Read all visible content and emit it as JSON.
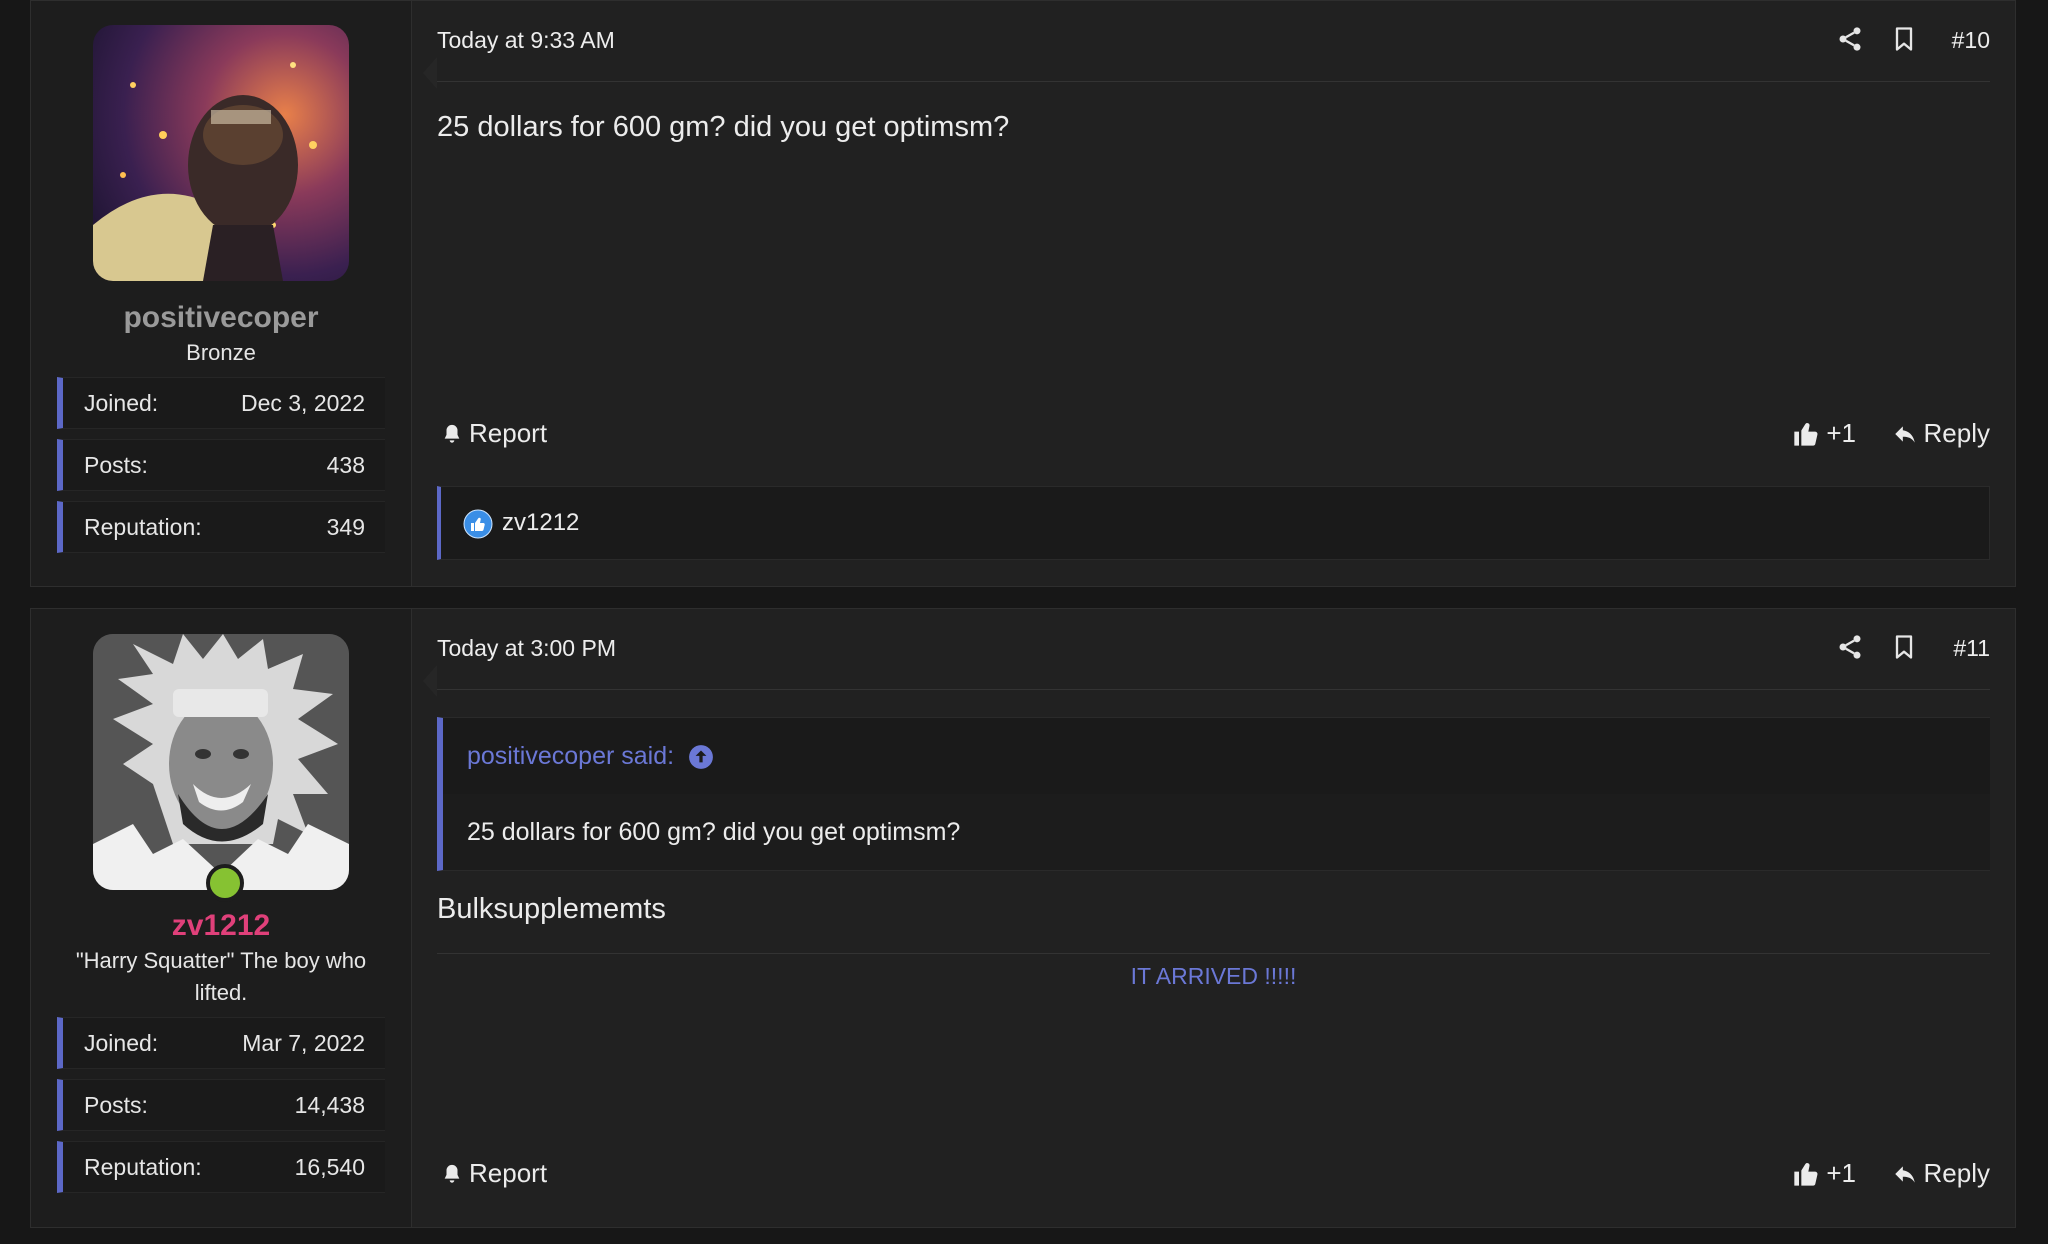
{
  "colors": {
    "accent": "#5c68c7",
    "link": "#6b78d6",
    "online": "#86c232",
    "username_highlight": "#e0407a",
    "username_muted": "#9a9a9a"
  },
  "posts": [
    {
      "username": "positivecoper",
      "user_title": "Bronze",
      "stats": [
        {
          "label": "Joined:",
          "value": "Dec 3, 2022"
        },
        {
          "label": "Posts:",
          "value": "438"
        },
        {
          "label": "Reputation:",
          "value": "349"
        }
      ],
      "date": "Today at 9:33 AM",
      "post_number": "#10",
      "body": "25 dollars for 600 gm? did you get optimsm?",
      "report_label": "Report",
      "like_label": "+1",
      "reply_label": "Reply",
      "likers": "zv1212"
    },
    {
      "username": "zv1212",
      "user_title": "\"Harry Squatter\" The boy who lifted.",
      "online": true,
      "stats": [
        {
          "label": "Joined:",
          "value": "Mar 7, 2022"
        },
        {
          "label": "Posts:",
          "value": "14,438"
        },
        {
          "label": "Reputation:",
          "value": "16,540"
        }
      ],
      "date": "Today at 3:00 PM",
      "post_number": "#11",
      "quote": {
        "author": "positivecoper said:",
        "text": "25 dollars for 600 gm? did you get optimsm?"
      },
      "body": "Bulksupplememts",
      "link_text": "IT ARRIVED !!!!!",
      "report_label": "Report",
      "like_label": "+1",
      "reply_label": "Reply"
    }
  ],
  "icons": {
    "share": "share-icon",
    "bookmark": "bookmark-icon",
    "report": "bell-icon",
    "like": "thumbs-up-icon",
    "reply": "reply-arrow-icon",
    "quote_jump": "arrow-up-circle-icon"
  }
}
